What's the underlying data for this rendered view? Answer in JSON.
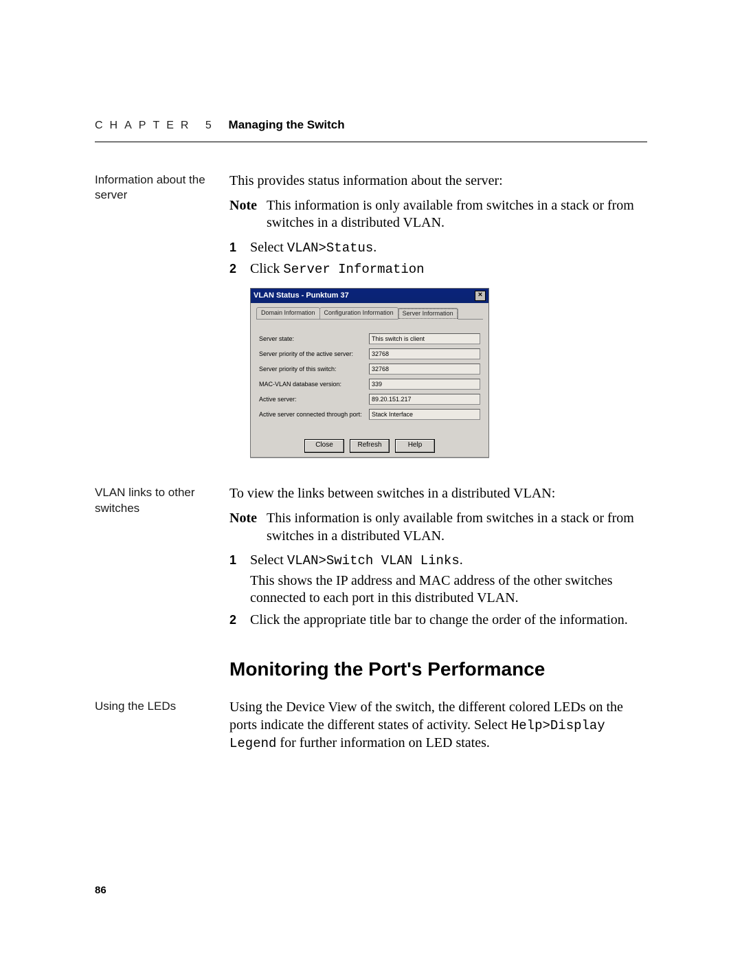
{
  "header": {
    "chapter_label": "CHAPTER 5",
    "chapter_title": "Managing the Switch"
  },
  "sections": {
    "server_info": {
      "margin_note": "Information about the server",
      "intro": "This provides status information about the server:",
      "note_label": "Note",
      "note_text": "This information is only available from switches in a stack or from switches in a distributed VLAN.",
      "step1_prefix": "Select ",
      "step1_code": "VLAN>Status",
      "step1_suffix": ".",
      "step2_prefix": "Click ",
      "step2_code": "Server Information"
    },
    "vlan_links": {
      "margin_note": "VLAN links to other switches",
      "intro": "To view the links between switches in a distributed VLAN:",
      "note_label": "Note",
      "note_text": "This information is only available from switches in a stack or from switches in a distributed VLAN.",
      "step1_prefix": "Select ",
      "step1_code": "VLAN>Switch VLAN Links",
      "step1_suffix": ".",
      "step1_body2": "This shows the IP address and MAC address of the other switches connected to each port in this distributed VLAN.",
      "step2_text": "Click the appropriate title bar to change the order of the information."
    },
    "monitoring": {
      "heading": "Monitoring the Port's Performance",
      "margin_note": "Using the LEDs",
      "text_part1": "Using the Device View of the switch, the different colored LEDs on the ports indicate the different states of activity. Select ",
      "code": "Help>Display Legend",
      "text_part2": " for further information on LED states."
    }
  },
  "dialog": {
    "title": "VLAN Status - Punktum 37",
    "tabs": {
      "t1": "Domain Information",
      "t2": "Configuration Information",
      "t3": "Server Information"
    },
    "fields": {
      "server_state_label": "Server state:",
      "server_state_value": "This switch is client",
      "priority_active_label": "Server priority of the active server:",
      "priority_active_value": "32768",
      "priority_this_label": "Server priority of this switch:",
      "priority_this_value": "32768",
      "db_version_label": "MAC-VLAN database version:",
      "db_version_value": "339",
      "active_server_label": "Active server:",
      "active_server_value": "89.20.151.217",
      "connected_port_label": "Active server connected through port:",
      "connected_port_value": "Stack Interface"
    },
    "buttons": {
      "close": "Close",
      "refresh": "Refresh",
      "help": "Help"
    }
  },
  "page_number": "86"
}
